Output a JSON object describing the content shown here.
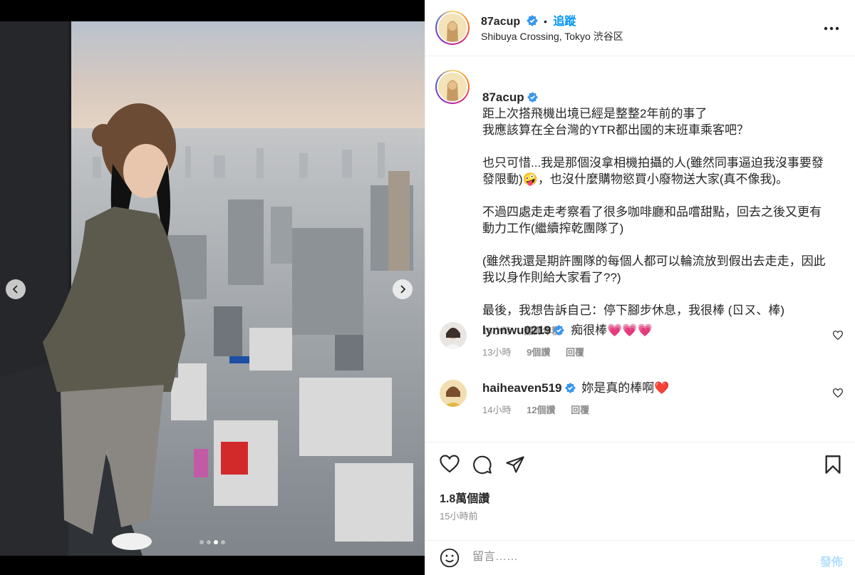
{
  "post": {
    "username": "87acup",
    "follow_label": "追蹤",
    "separator": "•",
    "location": "Shibuya Crossing, Tokyo 渋谷区",
    "more_icon": "more-horizontal-icon"
  },
  "caption": {
    "username": "87acup",
    "paragraphs": [
      "距上次搭飛機出境已經是整整2年前的事了\n我應該算在全台灣的YTR都出國的末班車乘客吧？",
      "也只可惜...我是那個沒拿相機拍攝的人(雖然同事逼迫我沒事要發發限動)🤪，也沒什麼購物慾買小廢物送大家(真不像我)。",
      "不過四處走走考察看了很多咖啡廳和品嚐甜點，回去之後又更有動力工作(繼續搾乾團隊了)",
      "(雖然我還是期許團隊的每個人都可以輪流放到假出去走走，因此我以身作則給大家看了??)",
      "最後，我想告訴自己：停下腳步休息，我很棒 (ㄖㄡ、棒)"
    ],
    "time": "15小時",
    "translate_label": "翻譯年糕"
  },
  "comments": [
    {
      "username": "lynnwu0219",
      "text": "痴很棒💗💗💗",
      "time": "13小時",
      "likes": "9個讚",
      "reply_label": "回覆"
    },
    {
      "username": "haiheaven519",
      "text": "妳是真的棒啊❤️",
      "time": "14小時",
      "likes": "12個讚",
      "reply_label": "回覆"
    }
  ],
  "stats": {
    "likes": "1.8萬個讚",
    "posted": "15小時前"
  },
  "composer": {
    "placeholder": "留言……",
    "post_label": "發佈"
  },
  "carousel": {
    "total": 4,
    "active_index": 2
  },
  "colors": {
    "accent": "#0095f6",
    "verified": "#3897f0",
    "post_disabled": "#b2dffc",
    "meta_gray": "#8e8e8e"
  }
}
